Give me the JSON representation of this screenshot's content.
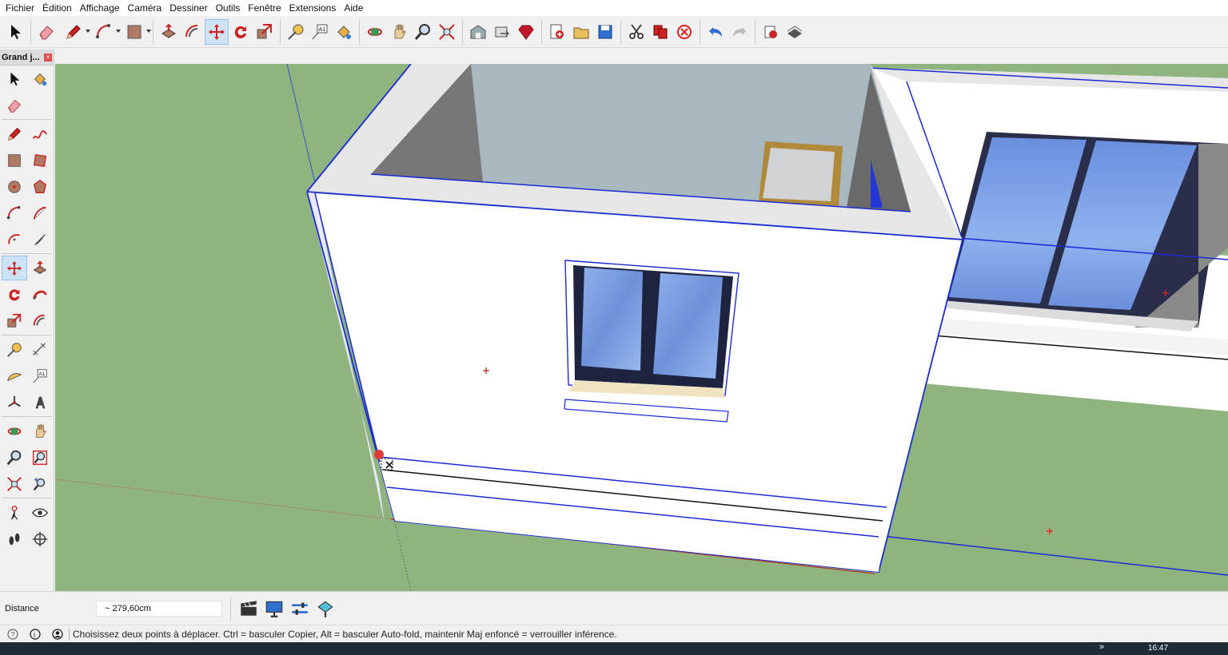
{
  "menu": [
    "Fichier",
    "Édition",
    "Affichage",
    "Caméra",
    "Dessiner",
    "Outils",
    "Fenêtre",
    "Extensions",
    "Aide"
  ],
  "toolbar": {
    "buttons": [
      {
        "name": "select-icon"
      },
      {
        "name": "eraser-icon"
      },
      {
        "name": "pencil-icon",
        "dropdown": true
      },
      {
        "name": "arc-icon",
        "dropdown": true
      },
      {
        "name": "rectangle-icon",
        "dropdown": true
      },
      {
        "name": "push-pull-icon"
      },
      {
        "name": "offset-icon"
      },
      {
        "name": "move-icon",
        "active": true
      },
      {
        "name": "rotate-icon"
      },
      {
        "name": "scale-icon"
      },
      {
        "name": "tape-measure-icon"
      },
      {
        "name": "text-icon"
      },
      {
        "name": "paint-bucket-icon"
      },
      {
        "name": "orbit-icon"
      },
      {
        "name": "pan-icon"
      },
      {
        "name": "zoom-icon"
      },
      {
        "name": "zoom-extents-icon"
      },
      {
        "name": "warehouse-icon"
      },
      {
        "name": "share-model-icon"
      },
      {
        "name": "ruby-icon"
      },
      {
        "name": "new-icon"
      },
      {
        "name": "open-icon"
      },
      {
        "name": "save-icon"
      },
      {
        "name": "cut-icon"
      },
      {
        "name": "copy-icon"
      },
      {
        "name": "delete-icon"
      },
      {
        "name": "undo-icon"
      },
      {
        "name": "redo-icon"
      },
      {
        "name": "print-icon"
      },
      {
        "name": "layout-icon"
      }
    ]
  },
  "palette": {
    "title": "Grand j...",
    "close": "×",
    "rows": [
      [
        "select-icon",
        "paint-bucket-icon"
      ],
      [
        "eraser-icon"
      ],
      [
        "pencil-icon",
        "freehand-icon"
      ],
      [
        "rectangle-icon",
        "rotated-rectangle-icon"
      ],
      [
        "circle-icon",
        "polygon-icon"
      ],
      [
        "arc-icon",
        "two-point-arc-icon"
      ],
      [
        "three-point-arc-icon",
        "pie-icon"
      ],
      [
        "move-icon",
        "push-pull-icon"
      ],
      [
        "rotate-icon",
        "follow-me-icon"
      ],
      [
        "scale-icon",
        "offset-icon"
      ],
      [
        "tape-measure-icon",
        "dimension-icon"
      ],
      [
        "protractor-icon",
        "text-icon"
      ],
      [
        "axes-icon",
        "3d-text-icon"
      ],
      [
        "orbit-icon",
        "pan-icon"
      ],
      [
        "zoom-icon",
        "zoom-window-icon"
      ],
      [
        "zoom-extents-icon",
        "previous-view-icon"
      ],
      [
        "position-camera-icon",
        "look-around-icon"
      ],
      [
        "walk-icon",
        "section-plane-icon"
      ]
    ]
  },
  "measure": {
    "label": "Distance",
    "value": "~ 279,60cm",
    "tools": [
      "scenes-icon",
      "presentation-icon",
      "sliders-icon",
      "sandbox-icon"
    ]
  },
  "status": {
    "text": "Choisissez deux points à déplacer.  Ctrl = basculer Copier, Alt = basculer Auto-fold, maintenir Maj enfoncé = verrouiller inférence."
  },
  "taskbar": {
    "chevron": "»",
    "clock": "16:47"
  },
  "colors": {
    "ground": "#8fb480",
    "selection": "#1a2bd6",
    "wall": "#ffffff",
    "glass": "#6b8fd8"
  }
}
